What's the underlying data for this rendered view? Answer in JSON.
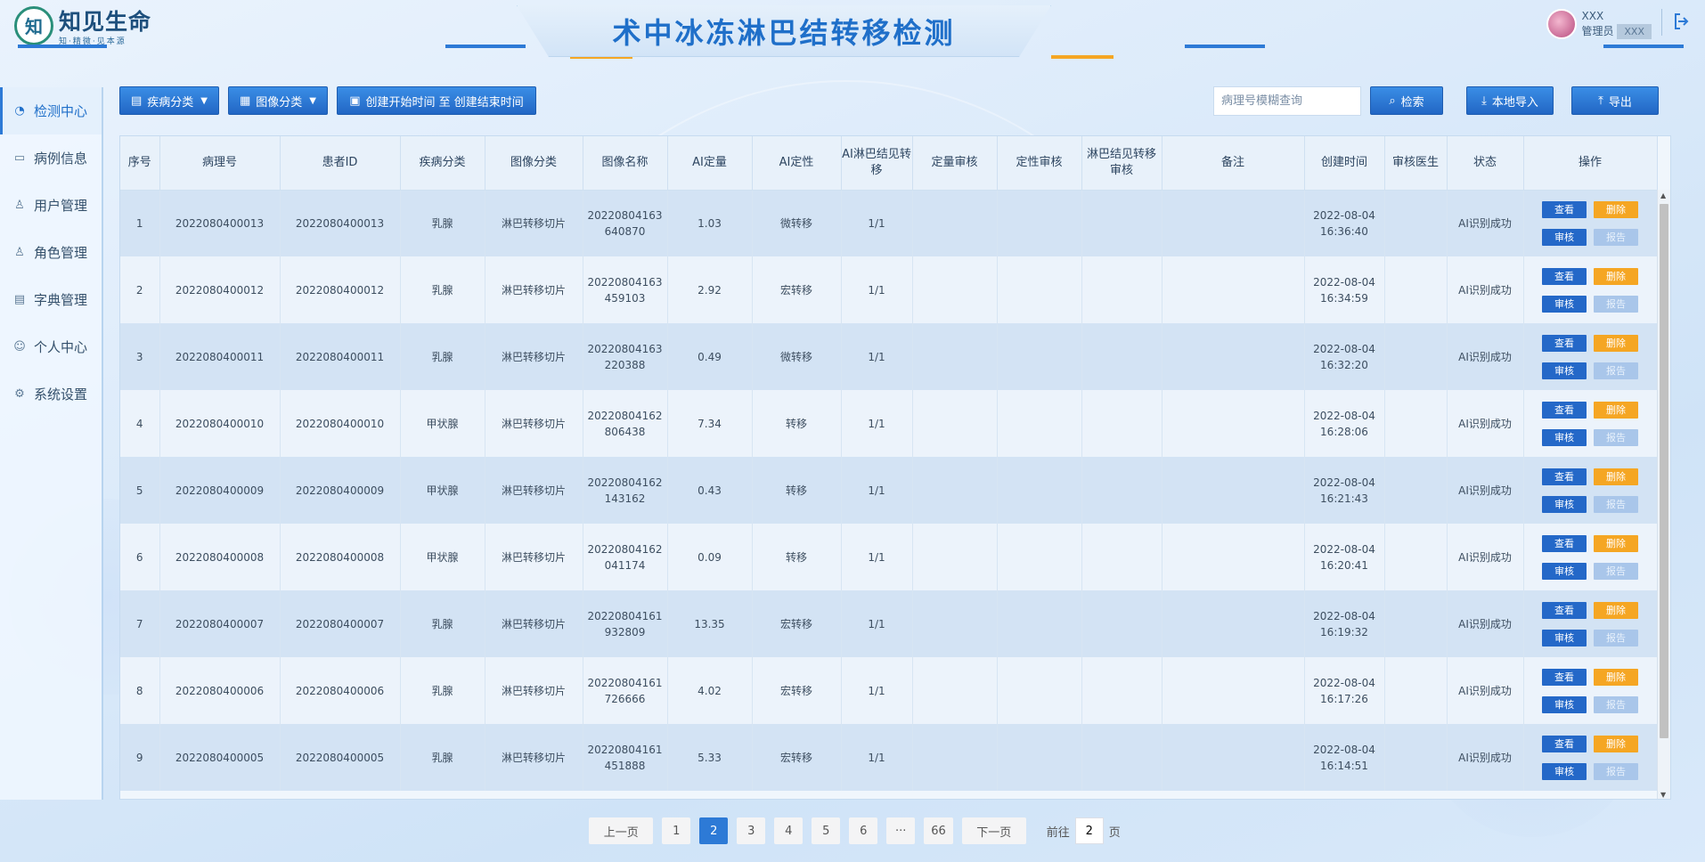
{
  "app": {
    "logo_mark": "知",
    "logo_title": "知见生命",
    "logo_sub": "知·精微·见本源",
    "page_title": "术中冰冻淋巴结转移检测"
  },
  "user": {
    "name": "XXX",
    "role_label": "管理员",
    "role_value": "XXX"
  },
  "sidebar": {
    "items": [
      {
        "label": "检测中心",
        "icon": "gauge-icon",
        "active": true
      },
      {
        "label": "病例信息",
        "icon": "folder-icon",
        "active": false
      },
      {
        "label": "用户管理",
        "icon": "user-icon",
        "active": false
      },
      {
        "label": "角色管理",
        "icon": "user-icon",
        "active": false
      },
      {
        "label": "字典管理",
        "icon": "book-icon",
        "active": false
      },
      {
        "label": "个人中心",
        "icon": "person-icon",
        "active": false
      },
      {
        "label": "系统设置",
        "icon": "gear-icon",
        "active": false
      }
    ]
  },
  "toolbar": {
    "disease_filter": "疾病分类",
    "image_filter": "图像分类",
    "date_range": "创建开始时间 至 创建结束时间",
    "search_placeholder": "病理号模糊查询",
    "search_button": "检索",
    "import_button": "本地导入",
    "export_button": "导出"
  },
  "table": {
    "headers": [
      "序号",
      "病理号",
      "患者ID",
      "疾病分类",
      "图像分类",
      "图像名称",
      "AI定量",
      "AI定性",
      "AI淋巴结见转移",
      "定量审核",
      "定性审核",
      "淋巴结见转移审核",
      "备注",
      "创建时间",
      "审核医生",
      "状态",
      "操作"
    ],
    "op_labels": {
      "view": "查看",
      "delete": "删除",
      "audit": "审核",
      "report": "报告"
    },
    "rows": [
      {
        "no": "1",
        "pathology": "2022080400013",
        "patient": "2022080400013",
        "disease": "乳腺",
        "image_type": "淋巴转移切片",
        "image_name": [
          "20220804163",
          "640870"
        ],
        "ai_quant": "1.03",
        "ai_qual": "微转移",
        "ai_lymph": "1/1",
        "quant_audit": "",
        "qual_audit": "",
        "lymph_audit": "",
        "note": "",
        "created": [
          "2022-08-04",
          "16:36:40"
        ],
        "doctor": "",
        "status": "AI识别成功"
      },
      {
        "no": "2",
        "pathology": "2022080400012",
        "patient": "2022080400012",
        "disease": "乳腺",
        "image_type": "淋巴转移切片",
        "image_name": [
          "20220804163",
          "459103"
        ],
        "ai_quant": "2.92",
        "ai_qual": "宏转移",
        "ai_lymph": "1/1",
        "quant_audit": "",
        "qual_audit": "",
        "lymph_audit": "",
        "note": "",
        "created": [
          "2022-08-04",
          "16:34:59"
        ],
        "doctor": "",
        "status": "AI识别成功"
      },
      {
        "no": "3",
        "pathology": "2022080400011",
        "patient": "2022080400011",
        "disease": "乳腺",
        "image_type": "淋巴转移切片",
        "image_name": [
          "20220804163",
          "220388"
        ],
        "ai_quant": "0.49",
        "ai_qual": "微转移",
        "ai_lymph": "1/1",
        "quant_audit": "",
        "qual_audit": "",
        "lymph_audit": "",
        "note": "",
        "created": [
          "2022-08-04",
          "16:32:20"
        ],
        "doctor": "",
        "status": "AI识别成功"
      },
      {
        "no": "4",
        "pathology": "2022080400010",
        "patient": "2022080400010",
        "disease": "甲状腺",
        "image_type": "淋巴转移切片",
        "image_name": [
          "20220804162",
          "806438"
        ],
        "ai_quant": "7.34",
        "ai_qual": "转移",
        "ai_lymph": "1/1",
        "quant_audit": "",
        "qual_audit": "",
        "lymph_audit": "",
        "note": "",
        "created": [
          "2022-08-04",
          "16:28:06"
        ],
        "doctor": "",
        "status": "AI识别成功"
      },
      {
        "no": "5",
        "pathology": "2022080400009",
        "patient": "2022080400009",
        "disease": "甲状腺",
        "image_type": "淋巴转移切片",
        "image_name": [
          "20220804162",
          "143162"
        ],
        "ai_quant": "0.43",
        "ai_qual": "转移",
        "ai_lymph": "1/1",
        "quant_audit": "",
        "qual_audit": "",
        "lymph_audit": "",
        "note": "",
        "created": [
          "2022-08-04",
          "16:21:43"
        ],
        "doctor": "",
        "status": "AI识别成功"
      },
      {
        "no": "6",
        "pathology": "2022080400008",
        "patient": "2022080400008",
        "disease": "甲状腺",
        "image_type": "淋巴转移切片",
        "image_name": [
          "20220804162",
          "041174"
        ],
        "ai_quant": "0.09",
        "ai_qual": "转移",
        "ai_lymph": "1/1",
        "quant_audit": "",
        "qual_audit": "",
        "lymph_audit": "",
        "note": "",
        "created": [
          "2022-08-04",
          "16:20:41"
        ],
        "doctor": "",
        "status": "AI识别成功"
      },
      {
        "no": "7",
        "pathology": "2022080400007",
        "patient": "2022080400007",
        "disease": "乳腺",
        "image_type": "淋巴转移切片",
        "image_name": [
          "20220804161",
          "932809"
        ],
        "ai_quant": "13.35",
        "ai_qual": "宏转移",
        "ai_lymph": "1/1",
        "quant_audit": "",
        "qual_audit": "",
        "lymph_audit": "",
        "note": "",
        "created": [
          "2022-08-04",
          "16:19:32"
        ],
        "doctor": "",
        "status": "AI识别成功"
      },
      {
        "no": "8",
        "pathology": "2022080400006",
        "patient": "2022080400006",
        "disease": "乳腺",
        "image_type": "淋巴转移切片",
        "image_name": [
          "20220804161",
          "726666"
        ],
        "ai_quant": "4.02",
        "ai_qual": "宏转移",
        "ai_lymph": "1/1",
        "quant_audit": "",
        "qual_audit": "",
        "lymph_audit": "",
        "note": "",
        "created": [
          "2022-08-04",
          "16:17:26"
        ],
        "doctor": "",
        "status": "AI识别成功"
      },
      {
        "no": "9",
        "pathology": "2022080400005",
        "patient": "2022080400005",
        "disease": "乳腺",
        "image_type": "淋巴转移切片",
        "image_name": [
          "20220804161",
          "451888"
        ],
        "ai_quant": "5.33",
        "ai_qual": "宏转移",
        "ai_lymph": "1/1",
        "quant_audit": "",
        "qual_audit": "",
        "lymph_audit": "",
        "note": "",
        "created": [
          "2022-08-04",
          "16:14:51"
        ],
        "doctor": "",
        "status": "AI识别成功"
      }
    ]
  },
  "pagination": {
    "prev": "上一页",
    "next": "下一页",
    "pages": [
      "1",
      "2",
      "3",
      "4",
      "5",
      "6",
      "···",
      "66"
    ],
    "current": "2",
    "goto_prefix": "前往",
    "goto_value": "2",
    "goto_suffix": "页"
  },
  "colors": {
    "accent": "#2d7ad6",
    "title": "#1f6fc9",
    "warning": "#f5a623"
  }
}
